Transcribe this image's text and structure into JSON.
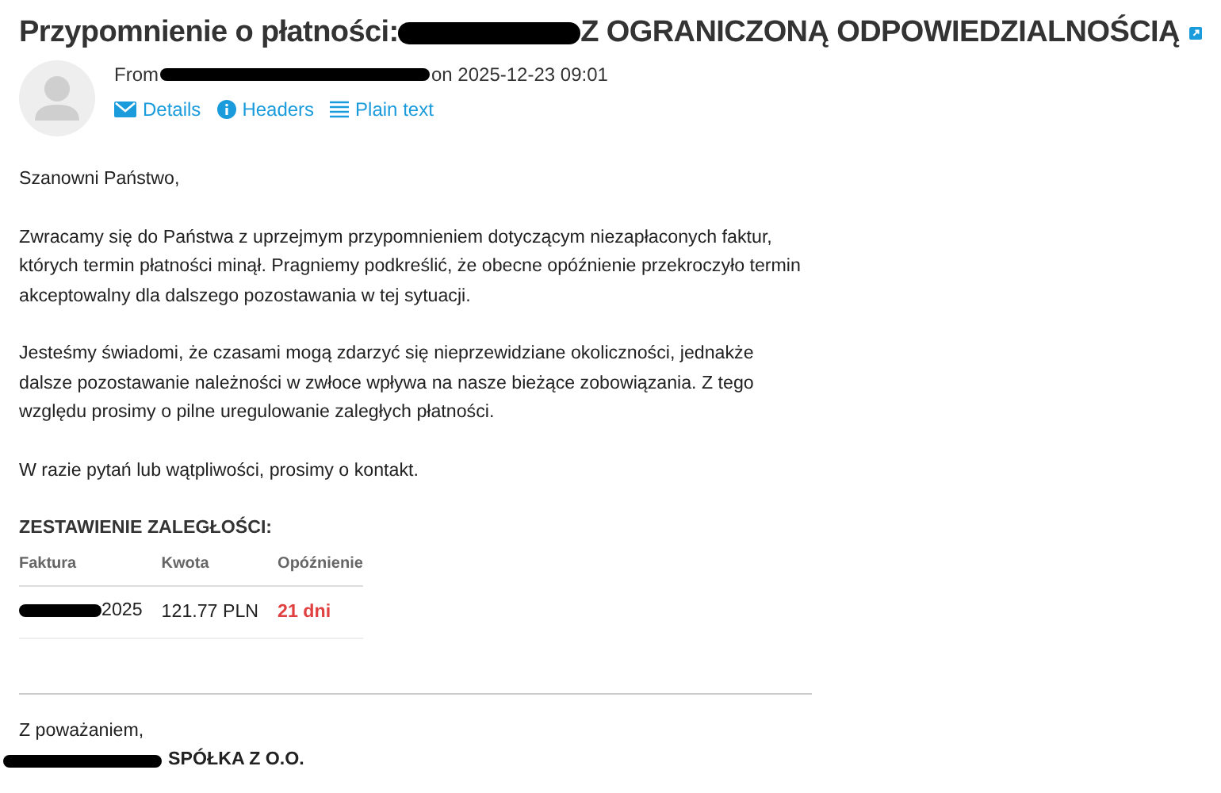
{
  "header": {
    "subject_start": "Przypomnienie o płatności:",
    "subject_end": "Z OGRANICZONĄ ODPOWIEDZIALNOŚCIĄ",
    "from_label": "From",
    "date": "on 2025-12-23 09:01",
    "links": [
      {
        "kind": "details",
        "label": "Details"
      },
      {
        "kind": "headers",
        "label": "Headers"
      },
      {
        "kind": "plain",
        "label": "Plain text"
      }
    ]
  },
  "body": {
    "greeting": "Szanowni Państwo,",
    "paragraphs": [
      "Zwracamy się do Państwa z uprzejmym przypomnieniem dotyczącym niezapłaconych faktur, których termin płatności minął. Pragniemy podkreślić, że obecne opóźnienie przekroczyło termin akceptowalny dla dalszego pozostawania w tej sytuacji.",
      "Jesteśmy świadomi, że czasami mogą zdarzyć się nieprzewidziane okoliczności, jednakże dalsze pozostawanie należności w zwłoce wpływa na nasze bieżące zobowiązania. Z tego względu prosimy o pilne uregulowanie zaległych płatności.",
      "W razie pytań lub wątpliwości, prosimy o kontakt."
    ],
    "summary_title": "ZESTAWIENIE ZALEGŁOŚCI:",
    "table": {
      "columns": [
        "Faktura",
        "Kwota",
        "Opóźnienie"
      ],
      "rows": [
        {
          "invoice": "2025",
          "amount": "121.77 PLN",
          "delay": "21 dni"
        }
      ]
    },
    "closing": "Z poważaniem,",
    "signature": "SPÓŁKA Z O.O."
  }
}
